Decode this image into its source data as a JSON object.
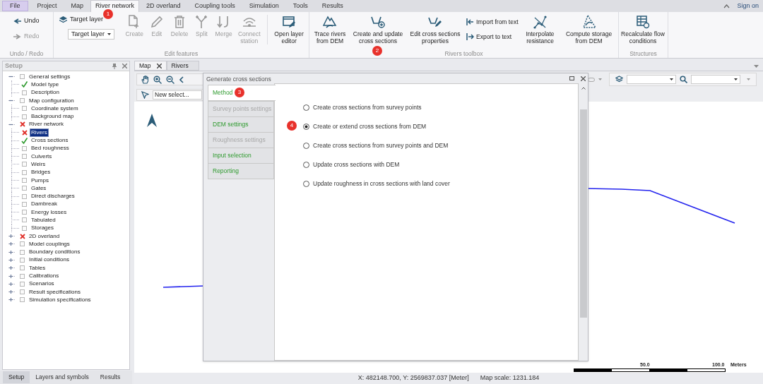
{
  "menu_tabs": [
    {
      "label": "File",
      "kind": "file",
      "selected": false
    },
    {
      "label": "Project",
      "kind": "tab",
      "selected": false
    },
    {
      "label": "Map",
      "kind": "tab",
      "selected": false
    },
    {
      "label": "River network",
      "kind": "tab",
      "selected": true
    },
    {
      "label": "2D overland",
      "kind": "tab",
      "selected": false
    },
    {
      "label": "Coupling tools",
      "kind": "tab",
      "selected": false
    },
    {
      "label": "Simulation",
      "kind": "tab",
      "selected": false
    },
    {
      "label": "Tools",
      "kind": "tab",
      "selected": false
    },
    {
      "label": "Results",
      "kind": "tab",
      "selected": false
    }
  ],
  "sign_on": "Sign on",
  "ribbon": {
    "undo": {
      "label": "Undo",
      "disabled": false
    },
    "redo": {
      "label": "Redo",
      "disabled": true
    },
    "undo_group": "Undo / Redo",
    "target_layer_button": "Target layer",
    "target_layer_select": "Target layer",
    "edit_tools": [
      {
        "label": "Create",
        "disabled": true
      },
      {
        "label": "Edit",
        "disabled": true
      },
      {
        "label": "Delete",
        "disabled": true
      },
      {
        "label": "Split",
        "disabled": true
      },
      {
        "label": "Merge",
        "disabled": true
      },
      {
        "label": "Connect station",
        "disabled": true
      },
      {
        "label": "Open layer editor",
        "disabled": false
      }
    ],
    "edit_group": "Edit features",
    "river_tools": [
      {
        "label": "Trace rivers from DEM",
        "kind": "big"
      },
      {
        "label": "Create and update cross sections",
        "kind": "big"
      },
      {
        "label": "Edit cross sections properties",
        "kind": "big"
      },
      {
        "label": "Import from text",
        "kind": "small"
      },
      {
        "label": "Export to text",
        "kind": "small"
      },
      {
        "label": "Interpolate resistance",
        "kind": "big"
      },
      {
        "label": "Compute storage from DEM",
        "kind": "big"
      }
    ],
    "river_group": "Rivers toolbox",
    "structure_tools": [
      {
        "label": "Recalculate flow conditions"
      }
    ],
    "structure_group": "Structures"
  },
  "setup_panel": {
    "title": "Setup",
    "tree": [
      {
        "label": "General settings",
        "kind": "none",
        "expanded": true,
        "selected": false,
        "children": [
          {
            "label": "Model type",
            "kind": "check",
            "selected": false
          },
          {
            "label": "Description",
            "kind": "none",
            "selected": false
          }
        ]
      },
      {
        "label": "Map configuration",
        "kind": "none",
        "expanded": true,
        "selected": false,
        "children": [
          {
            "label": "Coordinate system",
            "kind": "none",
            "selected": false
          },
          {
            "label": "Background map",
            "kind": "none",
            "selected": false
          }
        ]
      },
      {
        "label": "River network",
        "kind": "cross",
        "expanded": true,
        "selected": false,
        "children": [
          {
            "label": "Rivers",
            "kind": "cross",
            "selected": true
          },
          {
            "label": "Cross sections",
            "kind": "check",
            "selected": false
          },
          {
            "label": "Bed roughness",
            "kind": "none",
            "selected": false
          },
          {
            "label": "Culverts",
            "kind": "none",
            "selected": false
          },
          {
            "label": "Weirs",
            "kind": "none",
            "selected": false
          },
          {
            "label": "Bridges",
            "kind": "none",
            "selected": false
          },
          {
            "label": "Pumps",
            "kind": "none",
            "selected": false
          },
          {
            "label": "Gates",
            "kind": "none",
            "selected": false
          },
          {
            "label": "Direct discharges",
            "kind": "none",
            "selected": false
          },
          {
            "label": "Dambreak",
            "kind": "none",
            "selected": false
          },
          {
            "label": "Energy losses",
            "kind": "none",
            "selected": false
          },
          {
            "label": "Tabulated",
            "kind": "none",
            "selected": false
          },
          {
            "label": "Storages",
            "kind": "none",
            "selected": false
          }
        ]
      },
      {
        "label": "2D overland",
        "kind": "cross",
        "expanded": false,
        "selected": false
      },
      {
        "label": "Model couplings",
        "kind": "none",
        "expanded": false,
        "selected": false
      },
      {
        "label": "Boundary conditions",
        "kind": "none",
        "expanded": false,
        "selected": false
      },
      {
        "label": "Initial conditions",
        "kind": "none",
        "expanded": false,
        "selected": false
      },
      {
        "label": "Tables",
        "kind": "none",
        "expanded": false,
        "selected": false
      },
      {
        "label": "Calibrations",
        "kind": "none",
        "expanded": false,
        "selected": false
      },
      {
        "label": "Scenarios",
        "kind": "none",
        "expanded": false,
        "selected": false
      },
      {
        "label": "Result specifications",
        "kind": "none",
        "expanded": false,
        "selected": false
      },
      {
        "label": "Simulation specifications",
        "kind": "none",
        "expanded": false,
        "selected": false
      }
    ],
    "bottom_tabs": [
      {
        "label": "Setup",
        "selected": true
      },
      {
        "label": "Layers and symbols",
        "selected": false
      },
      {
        "label": "Results",
        "selected": false
      }
    ]
  },
  "doc_tabs": [
    {
      "label": "Map",
      "selected": true,
      "closable": true
    },
    {
      "label": "Rivers",
      "selected": false,
      "closable": false
    }
  ],
  "map_toolbar": {
    "selection_select": "New select..."
  },
  "dialog": {
    "title": "Generate cross sections",
    "tabs": [
      {
        "label": "Method",
        "selected": true,
        "disabled": false
      },
      {
        "label": "Survey points settings",
        "selected": false,
        "disabled": true
      },
      {
        "label": "DEM settings",
        "selected": false,
        "disabled": false
      },
      {
        "label": "Roughness settings",
        "selected": false,
        "disabled": true
      },
      {
        "label": "Input selection",
        "selected": false,
        "disabled": false
      },
      {
        "label": "Reporting",
        "selected": false,
        "disabled": false
      }
    ],
    "options": [
      {
        "label": "Create cross sections from survey points",
        "selected": false
      },
      {
        "label": "Create or extend cross sections from DEM",
        "selected": true
      },
      {
        "label": "Create cross sections from survey points and DEM",
        "selected": false
      },
      {
        "label": "Update cross sections with DEM",
        "selected": false
      },
      {
        "label": "Update roughness in cross sections with land cover",
        "selected": false
      }
    ]
  },
  "scale_bar": {
    "labels": [
      "50.0",
      "100.0",
      "Meters"
    ]
  },
  "status_bar": {
    "coordinates": "X: 482148.700, Y: 2569837.037 [Meter]",
    "map_scale": "Map scale: 1231.184"
  },
  "callouts": [
    "1",
    "2",
    "3",
    "4"
  ]
}
